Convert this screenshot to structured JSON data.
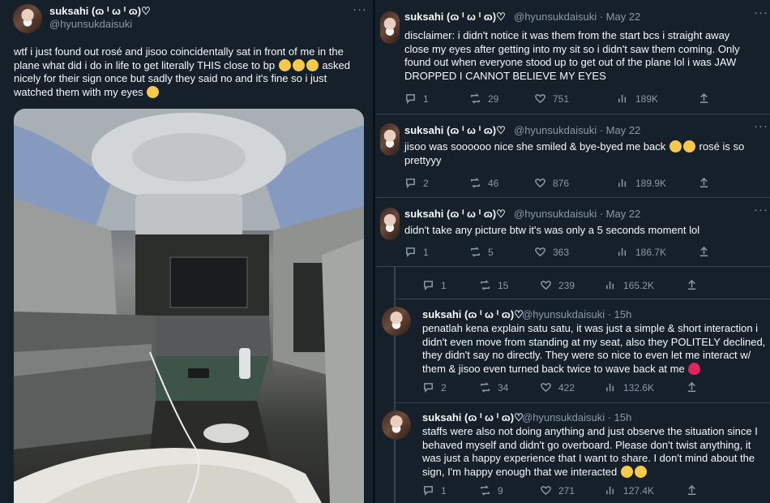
{
  "left_tweet": {
    "name": "suksahi (ɷ ᑊ ω ᑊ ɷ)♡",
    "handle": "@hyunsukdaisuki",
    "more": "···",
    "line1": "wtf i just found out rosé and jisoo coincidentally sat in front of me in the",
    "line2_a": "plane what did i do in life to get literally THIS close to bp",
    "line2_b": "asked",
    "line3": "nicely for their sign once but sadly they said no and it's fine so i just",
    "line4": "watched them with my eyes"
  },
  "right_tweets": [
    {
      "name": "suksahi (ɷ ᑊ ω ᑊ ɷ)♡",
      "handle": "@hyunsukdaisuki · May 22",
      "lines": [
        "disclaimer: i didn't notice it was them from the start bcs i straight away",
        "close my eyes after getting into my sit so i didn't saw them coming. Only",
        "found out when everyone stood up to get out of the plane lol i was JAW",
        "DROPPED I CANNOT BELIEVE MY EYES"
      ],
      "replies": "1",
      "retweets": "29",
      "likes": "751",
      "views": "189K"
    },
    {
      "name": "suksahi (ɷ ᑊ ω ᑊ ɷ)♡",
      "handle": "@hyunsukdaisuki · May 22",
      "line1_a": "jisoo was soooooo nice she smiled & bye-byed me back",
      "line1_b": "rosé is so",
      "line2": "prettyyy",
      "replies": "2",
      "retweets": "46",
      "likes": "876",
      "views": "189.9K"
    },
    {
      "name": "suksahi (ɷ ᑊ ω ᑊ ɷ)♡",
      "handle": "@hyunsukdaisuki · May 22",
      "line1": "didn't take any picture btw it's was only a 5 seconds moment lol",
      "replies": "1",
      "retweets": "5",
      "likes": "363",
      "views": "186.7K"
    },
    {
      "replies": "1",
      "retweets": "15",
      "likes": "239",
      "views": "165.2K"
    },
    {
      "name": "suksahi (ɷ ᑊ ω ᑊ ɷ)♡",
      "handle": "@hyunsukdaisuki · 15h",
      "lines": [
        "penatlah kena explain satu satu, it was just a simple & short interaction i",
        "didn't even move from standing at my seat, also they POLITELY declined,",
        "they didn't say no directly. They were so nice to even let me interact w/"
      ],
      "last_line": "them & jisoo even turned back twice to wave back at me",
      "replies": "2",
      "retweets": "34",
      "likes": "422",
      "views": "132.6K"
    },
    {
      "name": "suksahi (ɷ ᑊ ω ᑊ ɷ)♡",
      "handle": "@hyunsukdaisuki · 15h",
      "lines": [
        "staffs were also not doing anything and just observe the situation since I",
        "behaved myself and didn't go overboard. Please don't twist anything, it",
        "was just a happy experience that I want to share. I don't mind about the"
      ],
      "last_line": "sign, I'm happy enough that we interacted",
      "replies": "1",
      "retweets": "9",
      "likes": "271",
      "views": "127.4K"
    }
  ],
  "colors": {
    "background": "#15202b",
    "text": "#f7f9f9",
    "muted": "#8b98a5",
    "divider": "#38444d"
  },
  "icons": [
    "reply-icon",
    "retweet-icon",
    "like-icon",
    "views-icon",
    "share-icon",
    "more-icon"
  ]
}
